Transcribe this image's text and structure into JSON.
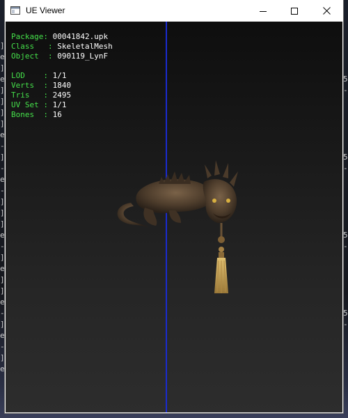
{
  "window": {
    "title": "UE Viewer",
    "minimize_glyph": "—",
    "maximize_glyph": "☐",
    "close_glyph": "✕"
  },
  "icons": {
    "app": "window-app-icon",
    "minimize": "minimize-icon",
    "maximize": "maximize-icon",
    "close": "close-icon"
  },
  "mesh_info": {
    "package": {
      "key": "Package",
      "value": "00041842.upk"
    },
    "class": {
      "key": "Class",
      "value": "SkeletalMesh"
    },
    "object": {
      "key": "Object",
      "value": "090119_LynF"
    },
    "lod": {
      "key": "LOD",
      "value": "1/1"
    },
    "verts": {
      "key": "Verts",
      "value": "1840"
    },
    "tris": {
      "key": "Tris",
      "value": "2495"
    },
    "uvset": {
      "key": "UV Set",
      "value": "1/1"
    },
    "bones": {
      "key": "Bones",
      "value": "16"
    }
  },
  "colors": {
    "label_green": "#45e04a",
    "value_white": "#ffffff",
    "axis_blue": "#1a2bd0",
    "model_bronze": "#5a4632",
    "tassel_gold": "#c8a050"
  },
  "background_console": {
    "left_glyphs": [
      "]",
      "e",
      "]",
      "e",
      "]",
      "]",
      "]",
      "]",
      "e",
      "-",
      "]",
      "-",
      "e",
      "-",
      "]",
      "]",
      "]",
      "e",
      "-",
      "]",
      "e",
      "]",
      "]",
      "e",
      "-",
      "]",
      "e",
      "-",
      "]",
      "e",
      "]"
    ],
    "right_glyphs": [
      "5",
      "-",
      "5",
      "-",
      "5",
      "-",
      "5",
      "-"
    ]
  }
}
